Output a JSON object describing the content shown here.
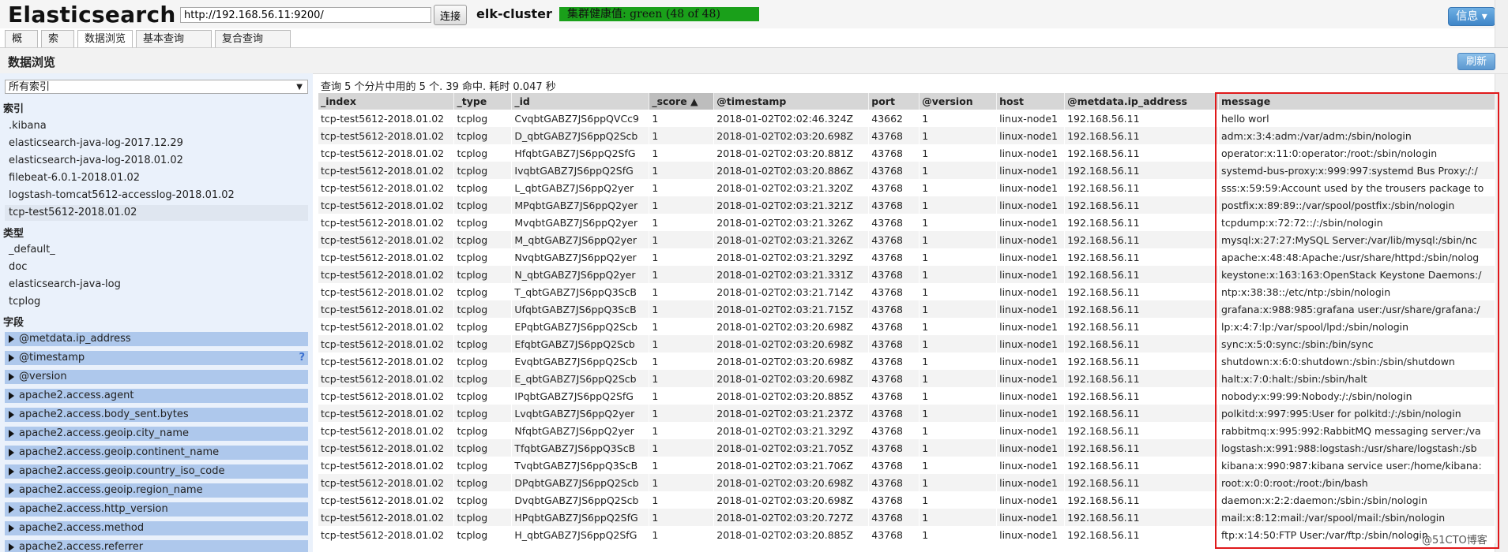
{
  "app": {
    "title": "Elasticsearch",
    "url_value": "http://192.168.56.11:9200/",
    "connect_label": "连接",
    "cluster_name": "elk-cluster",
    "health_text": "集群健康值: green (48 of 48)",
    "health_color": "#1aa01a",
    "info_label": "信息 ▾"
  },
  "tabs": [
    {
      "label": "概览",
      "plus": ""
    },
    {
      "label": "索引",
      "plus": ""
    },
    {
      "label": "数据浏览",
      "plus": ""
    },
    {
      "label": "基本查询",
      "plus": "[+]"
    },
    {
      "label": "复合查询",
      "plus": "[+]"
    }
  ],
  "section": {
    "title": "数据浏览",
    "refresh_label": "刷新"
  },
  "sidebar": {
    "select_value": "所有索引",
    "indices_heading": "索引",
    "indices": [
      ".kibana",
      "elasticsearch-java-log-2017.12.29",
      "elasticsearch-java-log-2018.01.02",
      "filebeat-6.0.1-2018.01.02",
      "logstash-tomcat5612-accesslog-2018.01.02",
      "tcp-test5612-2018.01.02"
    ],
    "types_heading": "类型",
    "types": [
      "_default_",
      "doc",
      "elasticsearch-java-log",
      "tcplog"
    ],
    "fields_heading": "字段",
    "fields": [
      "@metdata.ip_address",
      "@timestamp",
      "@version",
      "apache2.access.agent",
      "apache2.access.body_sent.bytes",
      "apache2.access.geoip.city_name",
      "apache2.access.geoip.continent_name",
      "apache2.access.geoip.country_iso_code",
      "apache2.access.geoip.region_name",
      "apache2.access.http_version",
      "apache2.access.method",
      "apache2.access.referrer"
    ],
    "field_help": "?"
  },
  "results": {
    "summary": "查询 5 个分片中用的 5 个. 39 命中. 耗时 0.047 秒",
    "columns": [
      "_index",
      "_type",
      "_id",
      "_score ▲",
      "@timestamp",
      "port",
      "@version",
      "host",
      "@metdata.ip_address",
      "message"
    ],
    "rows": [
      [
        "tcp-test5612-2018.01.02",
        "tcplog",
        "CvqbtGABZ7JS6ppQVCc9",
        "1",
        "2018-01-02T02:02:46.324Z",
        "43662",
        "1",
        "linux-node1",
        "192.168.56.11",
        "hello worl"
      ],
      [
        "tcp-test5612-2018.01.02",
        "tcplog",
        "D_qbtGABZ7JS6ppQ2Scb",
        "1",
        "2018-01-02T02:03:20.698Z",
        "43768",
        "1",
        "linux-node1",
        "192.168.56.11",
        "adm:x:3:4:adm:/var/adm:/sbin/nologin"
      ],
      [
        "tcp-test5612-2018.01.02",
        "tcplog",
        "HfqbtGABZ7JS6ppQ2SfG",
        "1",
        "2018-01-02T02:03:20.881Z",
        "43768",
        "1",
        "linux-node1",
        "192.168.56.11",
        "operator:x:11:0:operator:/root:/sbin/nologin"
      ],
      [
        "tcp-test5612-2018.01.02",
        "tcplog",
        "IvqbtGABZ7JS6ppQ2SfG",
        "1",
        "2018-01-02T02:03:20.886Z",
        "43768",
        "1",
        "linux-node1",
        "192.168.56.11",
        "systemd-bus-proxy:x:999:997:systemd Bus Proxy:/:/"
      ],
      [
        "tcp-test5612-2018.01.02",
        "tcplog",
        "L_qbtGABZ7JS6ppQ2yer",
        "1",
        "2018-01-02T02:03:21.320Z",
        "43768",
        "1",
        "linux-node1",
        "192.168.56.11",
        "sss:x:59:59:Account used by the trousers package to"
      ],
      [
        "tcp-test5612-2018.01.02",
        "tcplog",
        "MPqbtGABZ7JS6ppQ2yer",
        "1",
        "2018-01-02T02:03:21.321Z",
        "43768",
        "1",
        "linux-node1",
        "192.168.56.11",
        "postfix:x:89:89::/var/spool/postfix:/sbin/nologin"
      ],
      [
        "tcp-test5612-2018.01.02",
        "tcplog",
        "MvqbtGABZ7JS6ppQ2yer",
        "1",
        "2018-01-02T02:03:21.326Z",
        "43768",
        "1",
        "linux-node1",
        "192.168.56.11",
        "tcpdump:x:72:72::/:/sbin/nologin"
      ],
      [
        "tcp-test5612-2018.01.02",
        "tcplog",
        "M_qbtGABZ7JS6ppQ2yer",
        "1",
        "2018-01-02T02:03:21.326Z",
        "43768",
        "1",
        "linux-node1",
        "192.168.56.11",
        "mysql:x:27:27:MySQL Server:/var/lib/mysql:/sbin/nc"
      ],
      [
        "tcp-test5612-2018.01.02",
        "tcplog",
        "NvqbtGABZ7JS6ppQ2yer",
        "1",
        "2018-01-02T02:03:21.329Z",
        "43768",
        "1",
        "linux-node1",
        "192.168.56.11",
        "apache:x:48:48:Apache:/usr/share/httpd:/sbin/nolog"
      ],
      [
        "tcp-test5612-2018.01.02",
        "tcplog",
        "N_qbtGABZ7JS6ppQ2yer",
        "1",
        "2018-01-02T02:03:21.331Z",
        "43768",
        "1",
        "linux-node1",
        "192.168.56.11",
        "keystone:x:163:163:OpenStack Keystone Daemons:/"
      ],
      [
        "tcp-test5612-2018.01.02",
        "tcplog",
        "T_qbtGABZ7JS6ppQ3ScB",
        "1",
        "2018-01-02T02:03:21.714Z",
        "43768",
        "1",
        "linux-node1",
        "192.168.56.11",
        "ntp:x:38:38::/etc/ntp:/sbin/nologin"
      ],
      [
        "tcp-test5612-2018.01.02",
        "tcplog",
        "UfqbtGABZ7JS6ppQ3ScB",
        "1",
        "2018-01-02T02:03:21.715Z",
        "43768",
        "1",
        "linux-node1",
        "192.168.56.11",
        "grafana:x:988:985:grafana user:/usr/share/grafana:/"
      ],
      [
        "tcp-test5612-2018.01.02",
        "tcplog",
        "EPqbtGABZ7JS6ppQ2Scb",
        "1",
        "2018-01-02T02:03:20.698Z",
        "43768",
        "1",
        "linux-node1",
        "192.168.56.11",
        "lp:x:4:7:lp:/var/spool/lpd:/sbin/nologin"
      ],
      [
        "tcp-test5612-2018.01.02",
        "tcplog",
        "EfqbtGABZ7JS6ppQ2Scb",
        "1",
        "2018-01-02T02:03:20.698Z",
        "43768",
        "1",
        "linux-node1",
        "192.168.56.11",
        "sync:x:5:0:sync:/sbin:/bin/sync"
      ],
      [
        "tcp-test5612-2018.01.02",
        "tcplog",
        "EvqbtGABZ7JS6ppQ2Scb",
        "1",
        "2018-01-02T02:03:20.698Z",
        "43768",
        "1",
        "linux-node1",
        "192.168.56.11",
        "shutdown:x:6:0:shutdown:/sbin:/sbin/shutdown"
      ],
      [
        "tcp-test5612-2018.01.02",
        "tcplog",
        "E_qbtGABZ7JS6ppQ2Scb",
        "1",
        "2018-01-02T02:03:20.698Z",
        "43768",
        "1",
        "linux-node1",
        "192.168.56.11",
        "halt:x:7:0:halt:/sbin:/sbin/halt"
      ],
      [
        "tcp-test5612-2018.01.02",
        "tcplog",
        "IPqbtGABZ7JS6ppQ2SfG",
        "1",
        "2018-01-02T02:03:20.885Z",
        "43768",
        "1",
        "linux-node1",
        "192.168.56.11",
        "nobody:x:99:99:Nobody:/:/sbin/nologin"
      ],
      [
        "tcp-test5612-2018.01.02",
        "tcplog",
        "LvqbtGABZ7JS6ppQ2yer",
        "1",
        "2018-01-02T02:03:21.237Z",
        "43768",
        "1",
        "linux-node1",
        "192.168.56.11",
        "polkitd:x:997:995:User for polkitd:/:/sbin/nologin"
      ],
      [
        "tcp-test5612-2018.01.02",
        "tcplog",
        "NfqbtGABZ7JS6ppQ2yer",
        "1",
        "2018-01-02T02:03:21.329Z",
        "43768",
        "1",
        "linux-node1",
        "192.168.56.11",
        "rabbitmq:x:995:992:RabbitMQ messaging server:/va"
      ],
      [
        "tcp-test5612-2018.01.02",
        "tcplog",
        "TfqbtGABZ7JS6ppQ3ScB",
        "1",
        "2018-01-02T02:03:21.705Z",
        "43768",
        "1",
        "linux-node1",
        "192.168.56.11",
        "logstash:x:991:988:logstash:/usr/share/logstash:/sb"
      ],
      [
        "tcp-test5612-2018.01.02",
        "tcplog",
        "TvqbtGABZ7JS6ppQ3ScB",
        "1",
        "2018-01-02T02:03:21.706Z",
        "43768",
        "1",
        "linux-node1",
        "192.168.56.11",
        "kibana:x:990:987:kibana service user:/home/kibana:"
      ],
      [
        "tcp-test5612-2018.01.02",
        "tcplog",
        "DPqbtGABZ7JS6ppQ2Scb",
        "1",
        "2018-01-02T02:03:20.698Z",
        "43768",
        "1",
        "linux-node1",
        "192.168.56.11",
        "root:x:0:0:root:/root:/bin/bash"
      ],
      [
        "tcp-test5612-2018.01.02",
        "tcplog",
        "DvqbtGABZ7JS6ppQ2Scb",
        "1",
        "2018-01-02T02:03:20.698Z",
        "43768",
        "1",
        "linux-node1",
        "192.168.56.11",
        "daemon:x:2:2:daemon:/sbin:/sbin/nologin"
      ],
      [
        "tcp-test5612-2018.01.02",
        "tcplog",
        "HPqbtGABZ7JS6ppQ2SfG",
        "1",
        "2018-01-02T02:03:20.727Z",
        "43768",
        "1",
        "linux-node1",
        "192.168.56.11",
        "mail:x:8:12:mail:/var/spool/mail:/sbin/nologin"
      ],
      [
        "tcp-test5612-2018.01.02",
        "tcplog",
        "H_qbtGABZ7JS6ppQ2SfG",
        "1",
        "2018-01-02T02:03:20.885Z",
        "43768",
        "1",
        "linux-node1",
        "192.168.56.11",
        "ftp:x:14:50:FTP User:/var/ftp:/sbin/nologin"
      ]
    ]
  },
  "watermark": "@51CTO博客"
}
